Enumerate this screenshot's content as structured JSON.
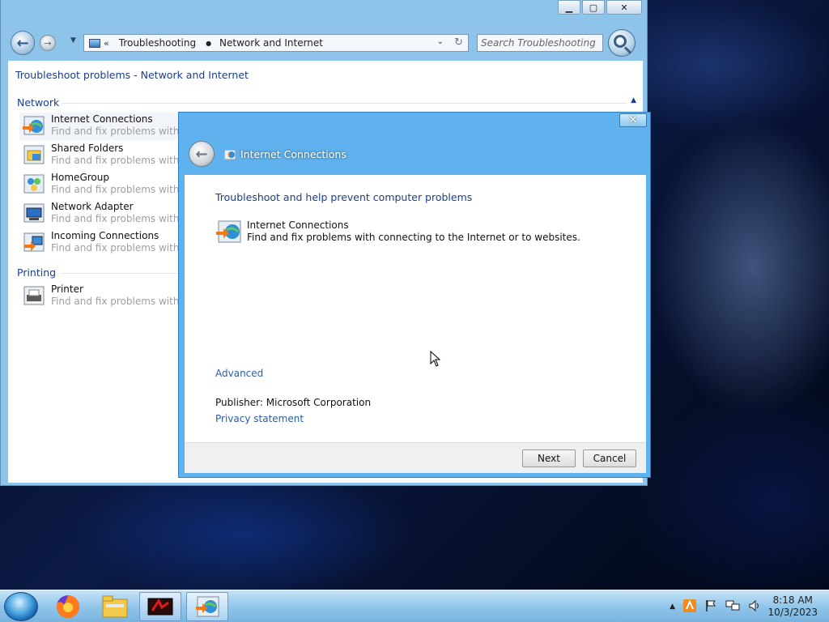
{
  "explorer": {
    "breadcrumb": [
      "Troubleshooting",
      "Network and Internet"
    ],
    "search_placeholder": "Search Troubleshooting",
    "content_title": "Troubleshoot problems - Network and Internet",
    "groups": [
      {
        "title": "Network",
        "items": [
          {
            "title": "Internet Connections",
            "desc": "Find and fix problems with co"
          },
          {
            "title": "Shared Folders",
            "desc": "Find and fix problems with acc"
          },
          {
            "title": "HomeGroup",
            "desc": "Find and fix problems with vie"
          },
          {
            "title": "Network Adapter",
            "desc": "Find and fix problems with wir"
          },
          {
            "title": "Incoming Connections",
            "desc": "Find and fix problems with inc"
          }
        ]
      },
      {
        "title": "Printing",
        "items": [
          {
            "title": "Printer",
            "desc": "Find and fix problems with pri"
          }
        ]
      }
    ]
  },
  "dialog": {
    "title": "Internet Connections",
    "heading": "Troubleshoot and help prevent computer problems",
    "item_title": "Internet Connections",
    "item_desc": "Find and fix problems with connecting to the Internet or to websites.",
    "advanced_link": "Advanced",
    "publisher_label": "Publisher:",
    "publisher_value": "Microsoft Corporation",
    "privacy_link": "Privacy statement",
    "next_label": "Next",
    "cancel_label": "Cancel"
  },
  "taskbar": {
    "time": "8:18 AM",
    "date": "10/3/2023"
  },
  "colors": {
    "link_blue": "#2a5ea8",
    "heading_blue": "#1a3e8a",
    "dialog_frame": "#5fb2ee",
    "taskbar": "#8ec4ea"
  }
}
